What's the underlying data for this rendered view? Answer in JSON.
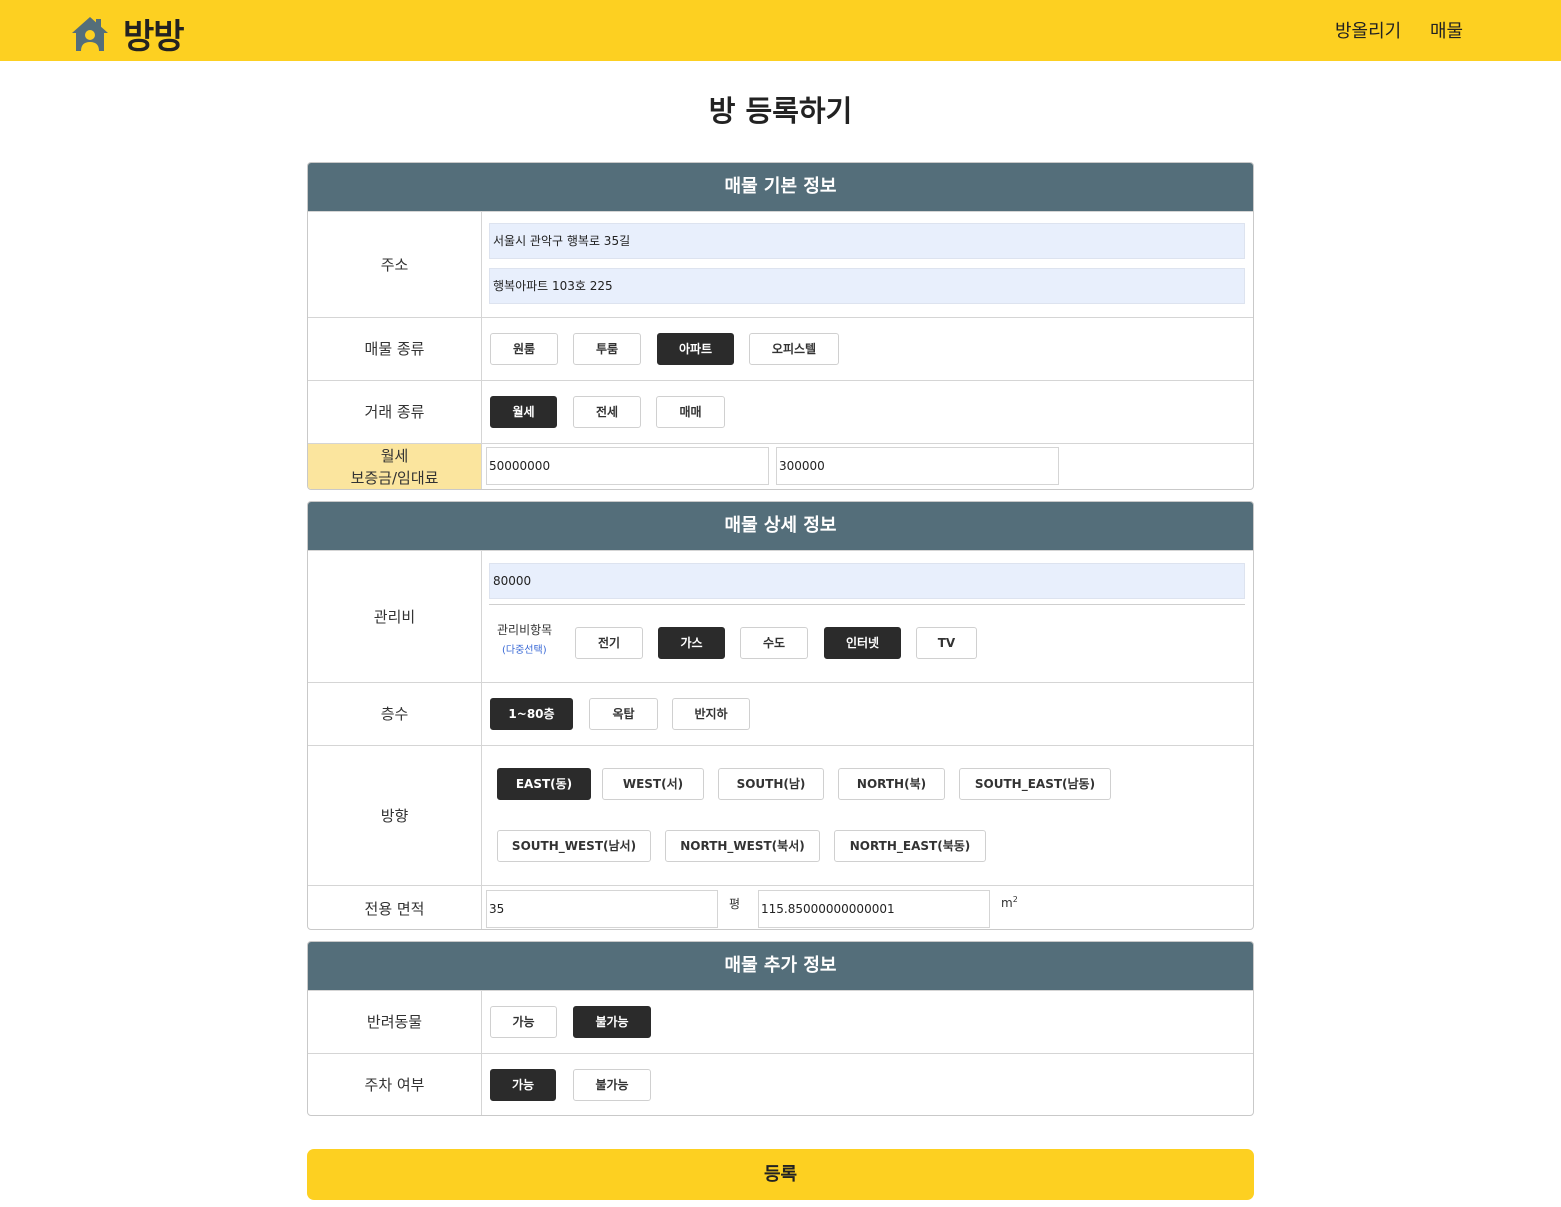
{
  "header": {
    "logo_text": "방방",
    "logo_icon": "house-user-icon",
    "nav": {
      "upload": "방올리기",
      "listings": "매물"
    },
    "color": "#fdd021"
  },
  "page_title": "방 등록하기",
  "basic": {
    "title": "매물 기본 정보",
    "address": {
      "label": "주소",
      "line1": "서울시 관악구 행복로 35길",
      "line2": "행복아파트 103호 225"
    },
    "property_type": {
      "label": "매물 종류",
      "options": [
        "원룸",
        "투룸",
        "아파트",
        "오피스텔"
      ],
      "selected": "아파트"
    },
    "deal_type": {
      "label": "거래 종류",
      "options": [
        "월세",
        "전세",
        "매매"
      ],
      "selected": "월세"
    },
    "price": {
      "label_line1": "월세",
      "label_line2": "보증금/임대료",
      "deposit": "50000000",
      "rent": "300000"
    }
  },
  "detail": {
    "title": "매물 상세 정보",
    "maintenance": {
      "label": "관리비",
      "value": "80000",
      "items_label": "관리비항목",
      "items_note": "(다중선택)",
      "items": [
        "전기",
        "가스",
        "수도",
        "인터넷",
        "TV"
      ],
      "selected": [
        "가스",
        "인터넷"
      ]
    },
    "floor": {
      "label": "층수",
      "options": [
        "1~80층",
        "옥탑",
        "반지하"
      ],
      "selected": "1~80층"
    },
    "direction": {
      "label": "방향",
      "options": [
        "EAST(동)",
        "WEST(서)",
        "SOUTH(남)",
        "NORTH(북)",
        "SOUTH_EAST(남동)",
        "SOUTH_WEST(남서)",
        "NORTH_WEST(북서)",
        "NORTH_EAST(북동)"
      ],
      "selected": "EAST(동)"
    },
    "area": {
      "label": "전용 면적",
      "pyeong": "35",
      "pyeong_unit": "평",
      "m2": "115.85000000000001",
      "m2_unit": "m",
      "m2_sup": "2"
    }
  },
  "extra": {
    "title": "매물 추가 정보",
    "pets": {
      "label": "반려동물",
      "options": [
        "가능",
        "불가능"
      ],
      "selected": "불가능"
    },
    "parking": {
      "label": "주차 여부",
      "options": [
        "가능",
        "불가능"
      ],
      "selected": "가능"
    }
  },
  "submit_label": "등록"
}
